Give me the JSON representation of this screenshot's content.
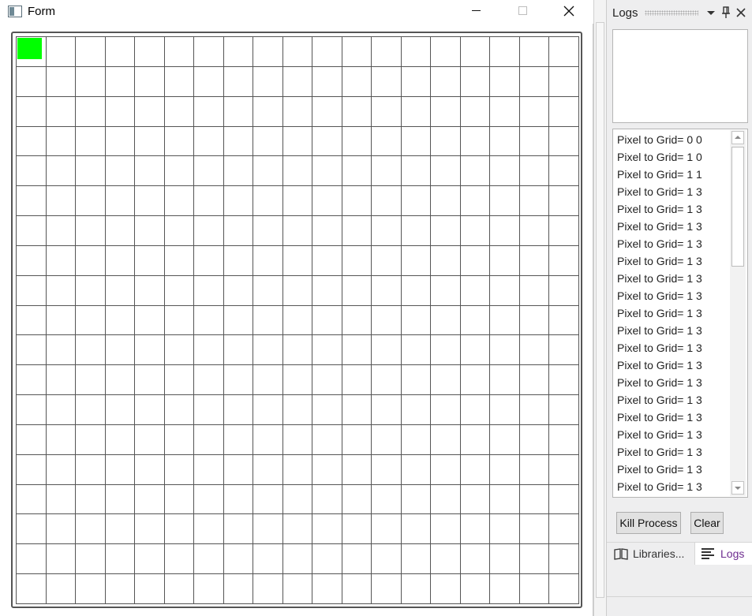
{
  "form_window": {
    "title": "Form",
    "controls": {
      "minimize": "minimize",
      "maximize": "maximize",
      "close": "close"
    },
    "grid": {
      "rows": 19,
      "cols": 19,
      "filled_cells": [
        {
          "row": 0,
          "col": 0,
          "color": "#00ff00"
        }
      ]
    }
  },
  "logs_panel": {
    "title": "Logs",
    "log_lines": [
      "Pixel to Grid= 0 0",
      "Pixel to Grid= 1 0",
      "Pixel to Grid= 1 1",
      "Pixel to Grid= 1 3",
      "Pixel to Grid= 1 3",
      "Pixel to Grid= 1 3",
      "Pixel to Grid= 1 3",
      "Pixel to Grid= 1 3",
      "Pixel to Grid= 1 3",
      "Pixel to Grid= 1 3",
      "Pixel to Grid= 1 3",
      "Pixel to Grid= 1 3",
      "Pixel to Grid= 1 3",
      "Pixel to Grid= 1 3",
      "Pixel to Grid= 1 3",
      "Pixel to Grid= 1 3",
      "Pixel to Grid= 1 3",
      "Pixel to Grid= 1 3",
      "Pixel to Grid= 1 3",
      "Pixel to Grid= 1 3",
      "Pixel to Grid= 1 3"
    ],
    "buttons": {
      "kill_process": "Kill Process",
      "clear": "Clear"
    },
    "tabs": [
      {
        "label": "Libraries...",
        "icon": "book-icon",
        "active": false
      },
      {
        "label": "Logs",
        "icon": "lines-icon",
        "active": true
      }
    ]
  },
  "colors": {
    "filled_cell": "#00ff00",
    "active_tab_text": "#6d2c8f",
    "grid_line": "#555555"
  }
}
